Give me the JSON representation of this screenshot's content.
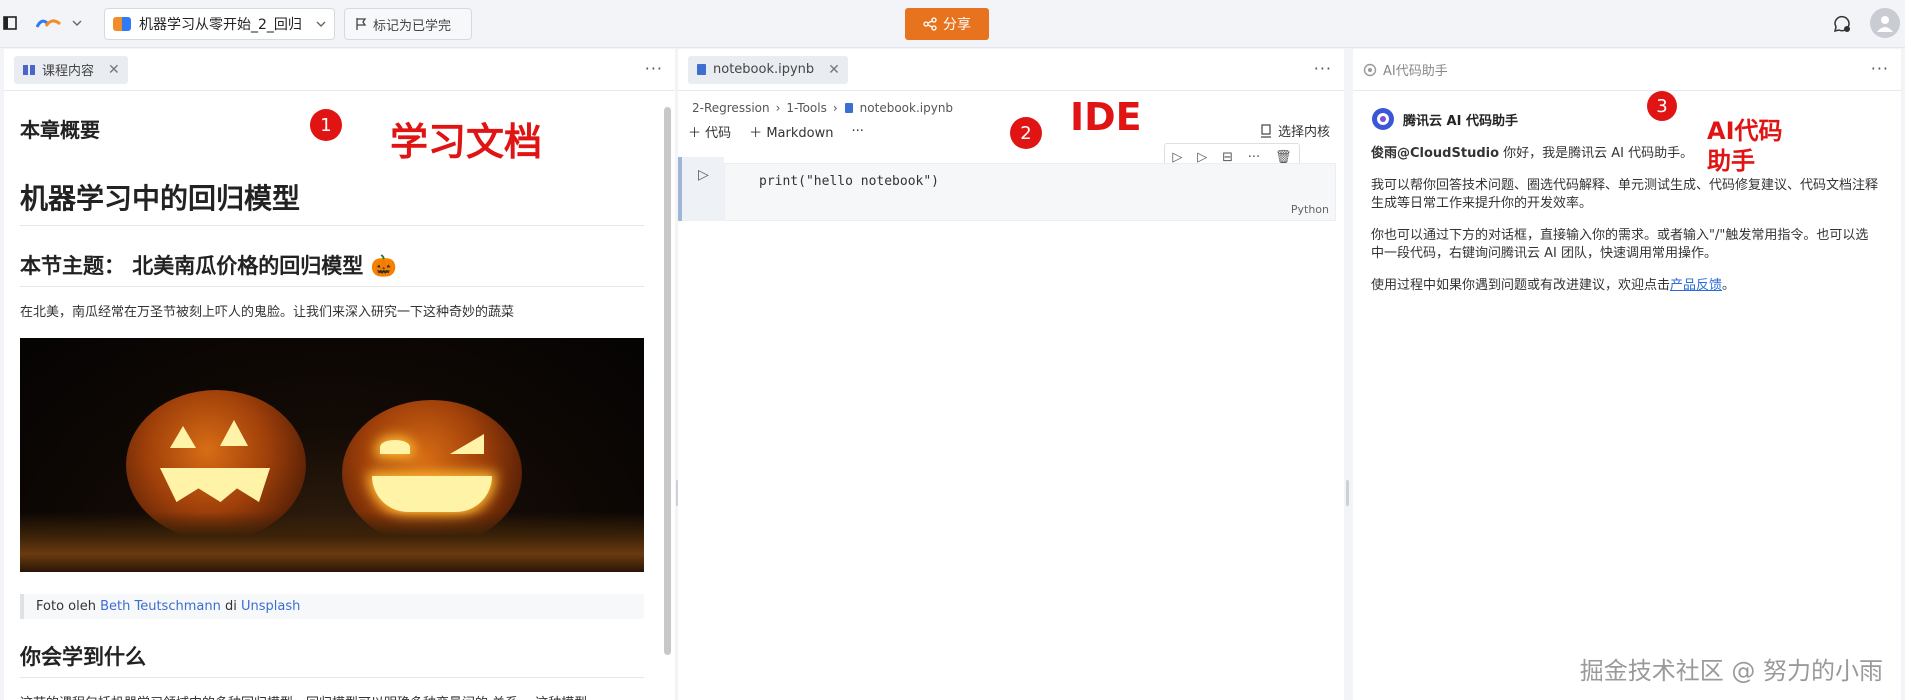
{
  "topbar": {
    "course_name": "机器学习从零开始_2_回归",
    "mark_done_label": "标记为已学完",
    "share_label": "分享"
  },
  "left": {
    "tab_label": "课程内容",
    "section_title": "本章概要",
    "h1": "机器学习中的回归模型",
    "h2_topic": "本节主题： 北美南瓜价格的回归模型 🎃",
    "intro": "在北美，南瓜经常在万圣节被刻上吓人的鬼脸。让我们来深入研究一下这种奇妙的蔬菜",
    "caption_prefix": "Foto oleh ",
    "caption_author": "Beth Teutschmann",
    "caption_mid": " di ",
    "caption_site": "Unsplash",
    "h2_learn": "你会学到什么",
    "learn_text": "这节的课程包括机器学习领域中的多种回归模型。回归模型可以明确多种变量间的 关系 。这种模型",
    "annotation_badge": "1",
    "annotation_text": "学习文档"
  },
  "mid": {
    "tab_label": "notebook.ipynb",
    "crumbs": [
      "2-Regression",
      "1-Tools",
      "notebook.ipynb"
    ],
    "add_code": "代码",
    "add_markdown": "Markdown",
    "kernel_label": "选择内核",
    "cell_source": "print(\"hello notebook\")",
    "cell_lang": "Python",
    "annotation_badge": "2",
    "annotation_text": "IDE"
  },
  "right": {
    "tab_label": "AI代码助手",
    "brand": "腾讯云 AI 代码助手",
    "greet_user": "俊雨@CloudStudio",
    "greet_text": " 你好，我是腾讯云 AI 代码助手。",
    "para1": "我可以帮你回答技术问题、圈选代码解释、单元测试生成、代码修复建议、代码文档注释生成等日常工作来提升你的开发效率。",
    "para2": "你也可以通过下方的对话框，直接输入你的需求。或者输入\"/\"触发常用指令。也可以选中一段代码，右键询问腾讯云 AI 团队，快速调用常用操作。",
    "para3_prefix": "使用过程中如果你遇到问题或有改进建议，欢迎点击",
    "para3_link": "产品反馈",
    "para3_suffix": "。",
    "annotation_badge": "3",
    "annotation_line1": "AI代码",
    "annotation_line2": "助手"
  },
  "watermark": "掘金技术社区 @ 努力的小雨",
  "colors": {
    "share": "#e8731f",
    "annotation": "#e11414",
    "link": "#3c6ecf"
  }
}
